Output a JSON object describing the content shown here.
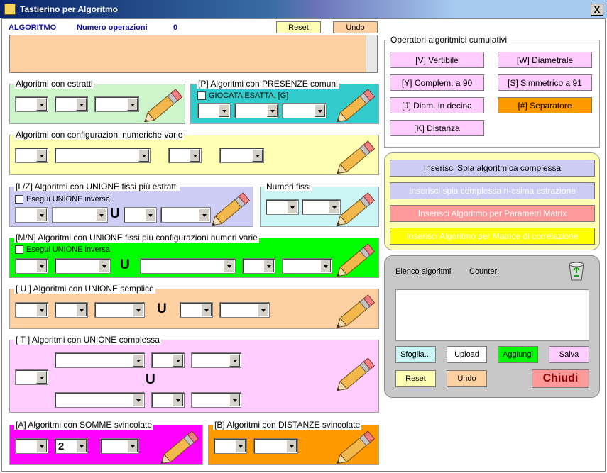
{
  "window": {
    "title": "Tastierino per Algoritmo",
    "close": "X"
  },
  "header": {
    "algoritmo": "ALGORITMO",
    "numero_operazioni": "Numero operazioni",
    "count": "0",
    "reset": "Reset",
    "undo": "Undo"
  },
  "panels": {
    "estratti": "Algoritmi con estratti",
    "presenze": "[P] Algoritmi con PRESENZE comuni",
    "giocata": "GIOCATA ESATTA. [G]",
    "configurazioni": "Algoritmi con configurazioni numeriche varie",
    "unione_fissi": "[L/Z] Algoritmi con UNIONE fissi più estratti",
    "esegui1": "Esegui UNIONE inversa",
    "numeri_fissi": "Numeri fissi",
    "unione_config": "[M/N] Algoritmi con UNIONE fissi più configurazioni numeri varie",
    "esegui2": "Esegui UNIONE inversa",
    "unione_semplice": "[ U ] Algoritmi con UNIONE semplice",
    "unione_complessa": "[ T ] Algoritmi con UNIONE complessa",
    "somme": "[A] Algoritmi con SOMME svincolate",
    "distanze": "[B] Algoritmi con DISTANZE svincolate",
    "u": "U",
    "somme_value": "2"
  },
  "operators": {
    "title": "Operatori algoritmici cumulativi",
    "v": "[V] Vertibile",
    "w": "[W] Diametrale",
    "y": "[Y] Complem. a 90",
    "s": "[S] Simmetrico  a 91",
    "j": "[J] Diam. in decina",
    "sep": "[#] Separatore",
    "k": "[K] Distanza"
  },
  "inserts": {
    "spia": "Inserisci Spia algoritmica complessa",
    "spia_n": "Inserisci spia complessa n-esima estrazione",
    "matrix": "Inserisci Algoritmo per Parametri Matrix",
    "matrice": "Inserisci Algoritmo per Matrice di correlazione"
  },
  "elenco": {
    "label": "Elenco algoritmi",
    "counter": "Counter:",
    "sfoglia": "Sfoglia...",
    "upload": "Upload",
    "aggiungi": "Aggiungi",
    "salva": "Salva",
    "reset": "Reset",
    "undo": "Undo",
    "chiudi": "Chiudi"
  },
  "colors": {
    "peach": "#fdd0a2",
    "green": "#ccf5cc",
    "teal": "#33cccc",
    "yellow": "#ffffb3",
    "lavender": "#ccccf5",
    "cyan": "#ccf5f5",
    "brightgreen": "#00ff00",
    "pink": "#ffccff",
    "magenta": "#ff00ff",
    "orange": "#ff9900"
  }
}
